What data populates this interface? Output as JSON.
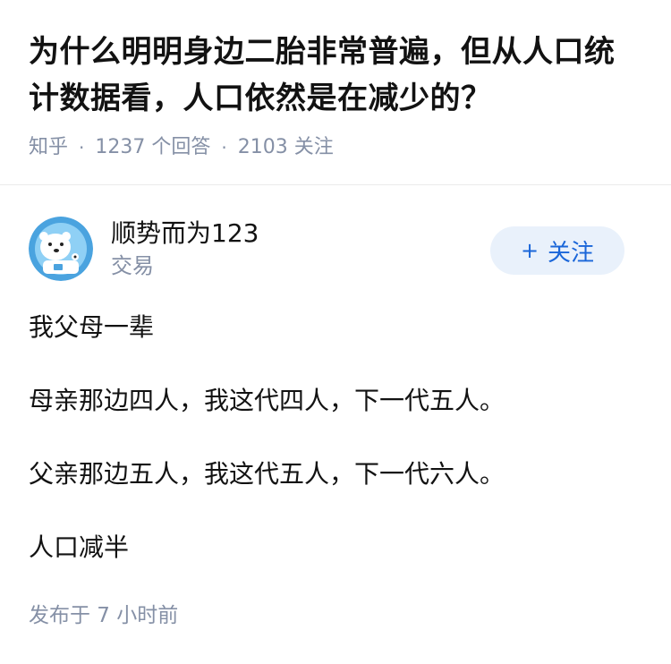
{
  "question": {
    "title": "为什么明明身边二胎非常普遍，但从人口统计数据看，人口依然是在减少的？",
    "source": "知乎",
    "answers": "1237 个回答",
    "followers": "2103 关注"
  },
  "answer": {
    "author": {
      "name": "顺势而为123",
      "subtitle": "交易",
      "avatar_icon": "polar-bear-astronaut-icon"
    },
    "follow_button": {
      "plus": "+",
      "label": "关注"
    },
    "paragraphs": [
      "我父母一辈",
      "母亲那边四人，我这代四人，下一代五人。",
      "父亲那边五人，我这代五人，下一代六人。",
      "人口减半"
    ],
    "published": "发布于 7 小时前"
  },
  "colors": {
    "meta_gray": "#8590a6",
    "follow_bg": "#e9f1fb",
    "follow_text": "#1a66d9",
    "avatar_bg": "#4aa3df"
  }
}
